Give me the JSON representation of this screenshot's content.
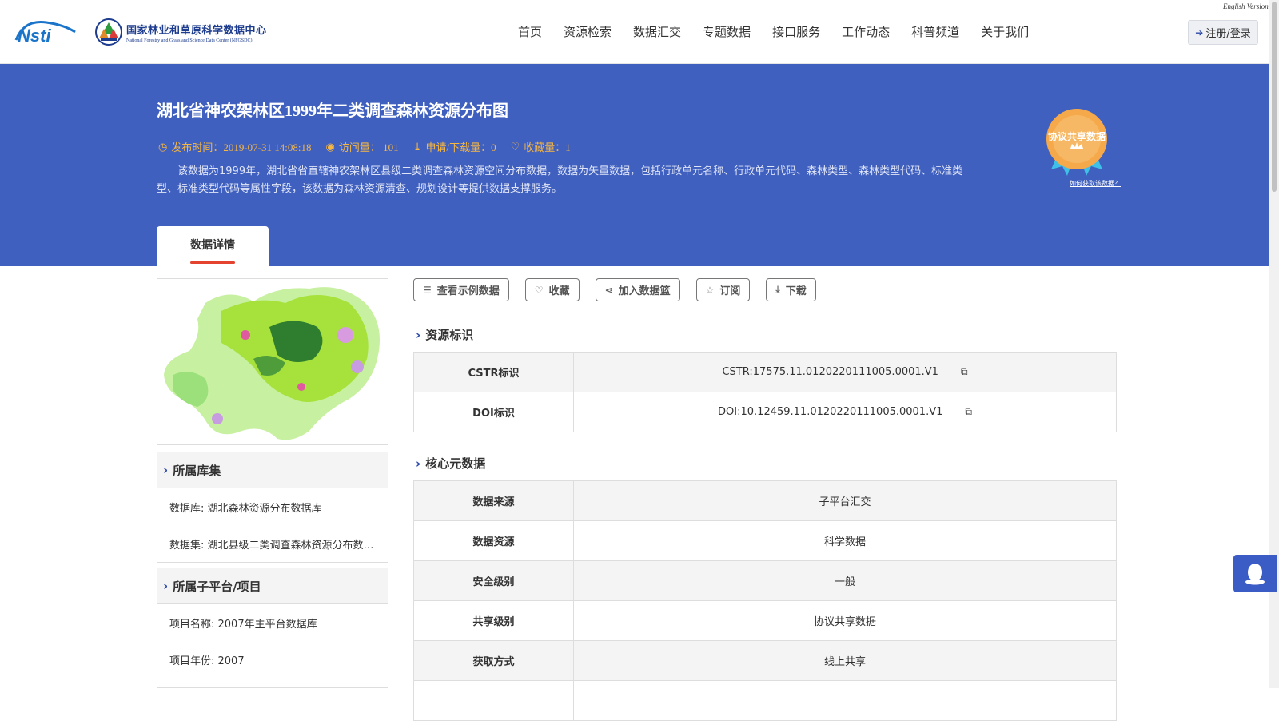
{
  "header": {
    "logo_left_text": "Nsti",
    "logo_cn": "国家林业和草原科学数据中心",
    "logo_en": "National Forestry and Grassland Science Data Center (NFGSDC)",
    "english_link": "English Version",
    "nav": [
      "首页",
      "资源检索",
      "数据汇交",
      "专题数据",
      "接口服务",
      "工作动态",
      "科普频道",
      "关于我们"
    ],
    "login": "注册/登录"
  },
  "dataset": {
    "title": "湖北省神农架林区1999年二类调查森林资源分布图",
    "published": "发布时间：2019-07-31 14:08:18",
    "visits": "访问量： 101",
    "downloads": "申请/下载量：0",
    "favorites": "收藏量：1",
    "description": "该数据为1999年，湖北省省直辖神农架林区县级二类调查森林资源空间分布数据，数据为矢量数据，包括行政单元名称、行政单元代码、森林类型、森林类型代码、标准类型、标准类型代码等属性字段，该数据为森林资源清查、规划设计等提供数据支撑服务。",
    "badge_label": "协议共享数据",
    "badge_link": "如何获取该数据？",
    "tab_label": "数据详情"
  },
  "sidebar": {
    "collection_title": "所属库集",
    "database": "数据库: 湖北森林资源分布数据库",
    "dataset": "数据集: 湖北县级二类调查森林资源分布数…",
    "platform_title": "所属子平台/项目",
    "project_name": "项目名称: 2007年主平台数据库",
    "project_year": "项目年份: 2007"
  },
  "actions": {
    "sample": "查看示例数据",
    "favorite": "收藏",
    "basket": "加入数据篮",
    "subscribe": "订阅",
    "download": "下载"
  },
  "identifiers": {
    "title": "资源标识",
    "rows": [
      {
        "key": "CSTR标识",
        "value": "CSTR:17575.11.0120220111005.0001.V1"
      },
      {
        "key": "DOI标识",
        "value": "DOI:10.12459.11.0120220111005.0001.V1"
      }
    ]
  },
  "core_metadata": {
    "title": "核心元数据",
    "rows": [
      {
        "key": "数据来源",
        "value": "子平台汇交"
      },
      {
        "key": "数据资源",
        "value": "科学数据"
      },
      {
        "key": "安全级别",
        "value": "一般"
      },
      {
        "key": "共享级别",
        "value": "协议共享数据"
      },
      {
        "key": "获取方式",
        "value": "线上共享"
      }
    ]
  },
  "colors": {
    "banner": "#4060bf",
    "accent_orange": "#f5b643",
    "tab_underline": "#e3432f",
    "nav_blue": "#2a48a8"
  }
}
